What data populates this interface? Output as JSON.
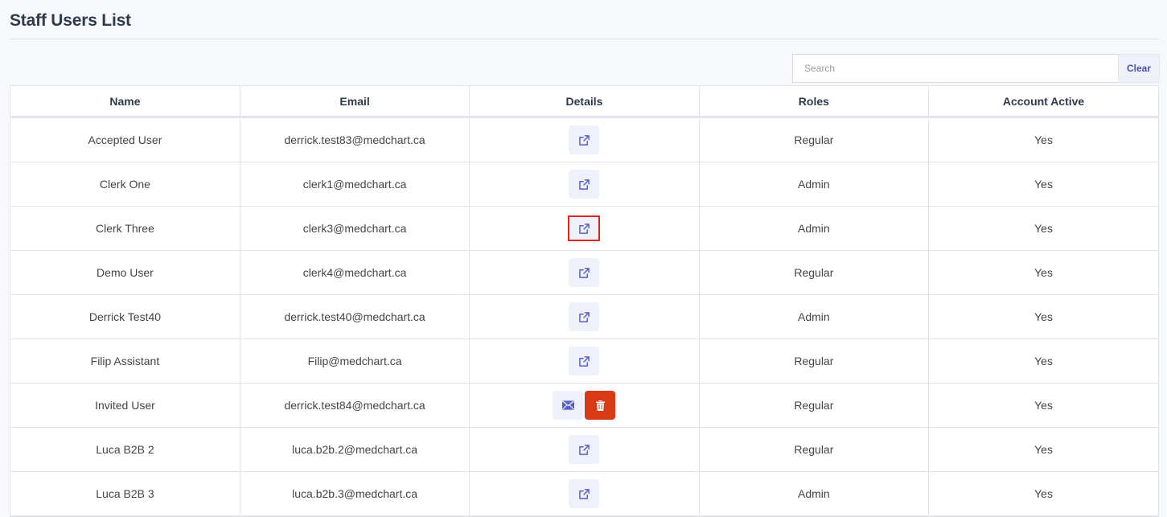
{
  "page": {
    "title": "Staff Users List"
  },
  "search": {
    "placeholder": "Search",
    "value": "",
    "clear_label": "Clear"
  },
  "table": {
    "columns": [
      "Name",
      "Email",
      "Details",
      "Roles",
      "Account Active"
    ],
    "rows": [
      {
        "name": "Accepted User",
        "email": "derrick.test83@medchart.ca",
        "details": "open-link",
        "role": "Regular",
        "active": "Yes"
      },
      {
        "name": "Clerk One",
        "email": "clerk1@medchart.ca",
        "details": "open-link",
        "role": "Admin",
        "active": "Yes"
      },
      {
        "name": "Clerk Three",
        "email": "clerk3@medchart.ca",
        "details": "open-link",
        "role": "Admin",
        "active": "Yes",
        "highlighted": true
      },
      {
        "name": "Demo User",
        "email": "clerk4@medchart.ca",
        "details": "open-link",
        "role": "Regular",
        "active": "Yes"
      },
      {
        "name": "Derrick Test40",
        "email": "derrick.test40@medchart.ca",
        "details": "open-link",
        "role": "Admin",
        "active": "Yes"
      },
      {
        "name": "Filip Assistant",
        "email": "Filip@medchart.ca",
        "details": "open-link",
        "role": "Regular",
        "active": "Yes"
      },
      {
        "name": "Invited User",
        "email": "derrick.test84@medchart.ca",
        "details": "resend-delete",
        "role": "Regular",
        "active": "Yes"
      },
      {
        "name": "Luca B2B 2",
        "email": "luca.b2b.2@medchart.ca",
        "details": "open-link",
        "role": "Regular",
        "active": "Yes"
      },
      {
        "name": "Luca B2B 3",
        "email": "luca.b2b.3@medchart.ca",
        "details": "open-link",
        "role": "Admin",
        "active": "Yes"
      }
    ]
  },
  "icons": {
    "open_link": "external-link-icon",
    "resend": "envelope-icon",
    "delete": "trash-icon"
  },
  "colors": {
    "accent": "#5b5fc7",
    "danger": "#d93a16",
    "highlight": "#e02424",
    "icon_button_bg": "#eef1fa"
  }
}
